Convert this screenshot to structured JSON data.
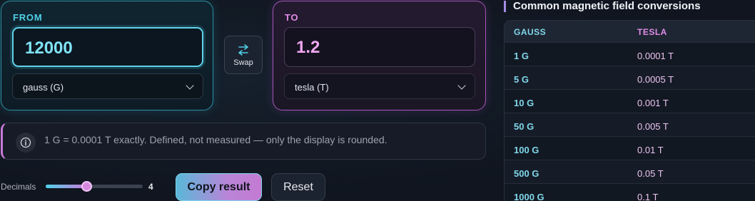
{
  "from": {
    "label": "FROM",
    "value": "12000",
    "unit": "gauss (G)"
  },
  "to": {
    "label": "TO",
    "value": "1.2",
    "unit": "tesla (T)"
  },
  "swap": {
    "label": "Swap",
    "icon": "swap-arrows-icon"
  },
  "info": {
    "icon": "info-icon",
    "text": "1 G = 0.0001 T exactly. Defined, not measured — only the display is rounded."
  },
  "controls": {
    "decimals_label": "Decimals",
    "decimals_value": "4",
    "decimals_fraction": 0.42,
    "copy_label": "Copy result",
    "reset_label": "Reset"
  },
  "table": {
    "title": "Common magnetic field conversions",
    "headers": {
      "gauss": "GAUSS",
      "tesla": "TESLA"
    },
    "rows": [
      {
        "gauss": "1 G",
        "tesla": "0.0001 T"
      },
      {
        "gauss": "5 G",
        "tesla": "0.0005 T"
      },
      {
        "gauss": "10 G",
        "tesla": "0.001 T"
      },
      {
        "gauss": "50 G",
        "tesla": "0.005 T"
      },
      {
        "gauss": "100 G",
        "tesla": "0.01 T"
      },
      {
        "gauss": "500 G",
        "tesla": "0.05 T"
      },
      {
        "gauss": "1000 G",
        "tesla": "0.1 T"
      }
    ]
  },
  "colors": {
    "from_accent": "#4fd0e8",
    "to_accent": "#e08ce8"
  }
}
